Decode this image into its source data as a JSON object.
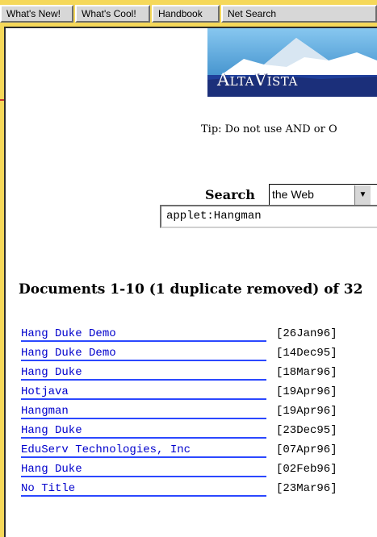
{
  "toolbar": {
    "buttons": [
      "What's New!",
      "What's Cool!",
      "Handbook",
      "Net Search"
    ]
  },
  "logo": {
    "text": "AltaVista"
  },
  "tip": "Tip: Do not use AND or O",
  "search": {
    "label": "Search",
    "scope": "the Web",
    "query": "applet:Hangman"
  },
  "summary": "Documents 1-10 (1 duplicate removed) of 32",
  "results": [
    {
      "title": "Hang Duke Demo",
      "date": "[26Jan96]"
    },
    {
      "title": "Hang Duke Demo",
      "date": "[14Dec95]"
    },
    {
      "title": "Hang Duke",
      "date": "[18Mar96]"
    },
    {
      "title": "Hotjava",
      "date": "[19Apr96]"
    },
    {
      "title": "Hangman",
      "date": "[19Apr96]"
    },
    {
      "title": "Hang Duke",
      "date": "[23Dec95]"
    },
    {
      "title": "EduServ Technologies, Inc",
      "date": "[07Apr96]"
    },
    {
      "title": "Hang Duke",
      "date": "[02Feb96]"
    },
    {
      "title": "No Title",
      "date": "[23Mar96]"
    }
  ]
}
